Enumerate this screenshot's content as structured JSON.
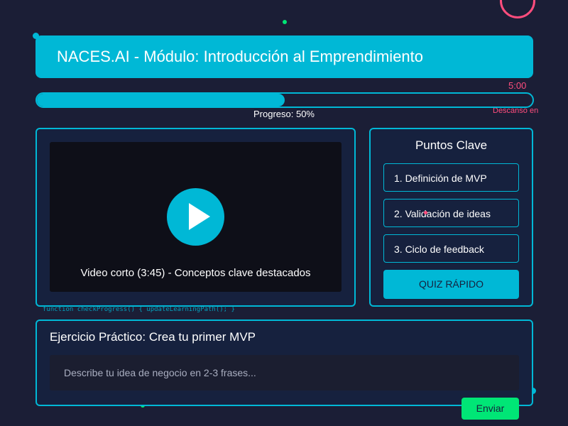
{
  "header": {
    "title": "NACES.AI - Módulo: Introducción al Emprendimiento"
  },
  "timer": {
    "time": "5:00",
    "break_label": "Descanso en"
  },
  "progress": {
    "percent": 50,
    "label": "Progreso: 50%"
  },
  "video": {
    "caption": "Video corto (3:45) - Conceptos clave destacados",
    "play_icon": "play-icon"
  },
  "code_snippet": "function checkProgress() { updateLearningPath(); }",
  "key_points": {
    "title": "Puntos Clave",
    "items": [
      {
        "label": "1. Definición de MVP"
      },
      {
        "label": "2. Validación de ideas"
      },
      {
        "label": "3. Ciclo de feedback"
      }
    ],
    "quiz_label": "QUIZ RÁPIDO"
  },
  "exercise": {
    "title": "Ejercicio Práctico: Crea tu primer MVP",
    "placeholder": "Describe tu idea de negocio en 2-3 frases...",
    "value": "",
    "submit_label": "Enviar"
  },
  "colors": {
    "background": "#1b1e36",
    "panel": "#16213e",
    "accent": "#00b8d6",
    "highlight": "#ff4d7d",
    "success": "#00e676"
  }
}
